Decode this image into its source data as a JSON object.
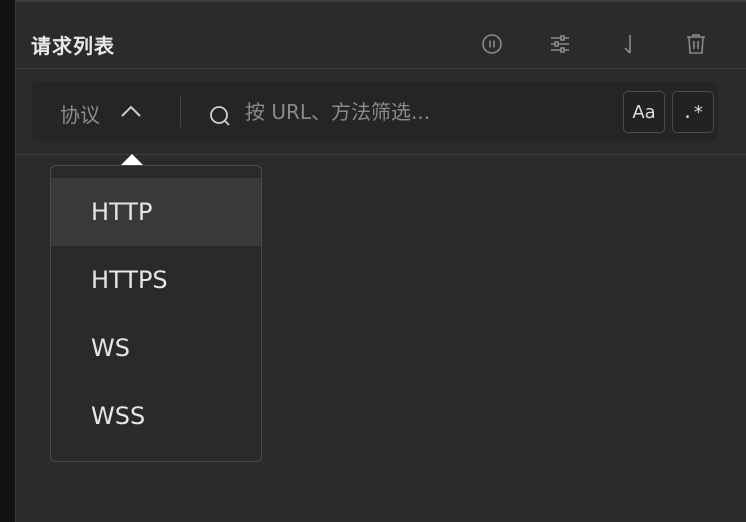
{
  "panel": {
    "title": "请求列表",
    "icons": [
      "pause-icon",
      "filter-settings-icon",
      "scroll-to-bottom-icon",
      "trash-icon"
    ]
  },
  "filter": {
    "protocol_label": "协议",
    "search_placeholder": "按 URL、方法筛选...",
    "match_case_label": "Aa",
    "regex_label": ".*"
  },
  "protocol_menu": {
    "options": [
      "HTTP",
      "HTTPS",
      "WS",
      "WSS"
    ],
    "highlighted": "HTTP"
  },
  "colors": {
    "panel_bg": "#2b2b2b",
    "filterbar_bg": "#252525",
    "menu_bg": "#2a2a2a",
    "menu_highlight": "#3a3a3a",
    "text_primary": "#e6e6e6",
    "text_muted": "#8a8a8a"
  }
}
